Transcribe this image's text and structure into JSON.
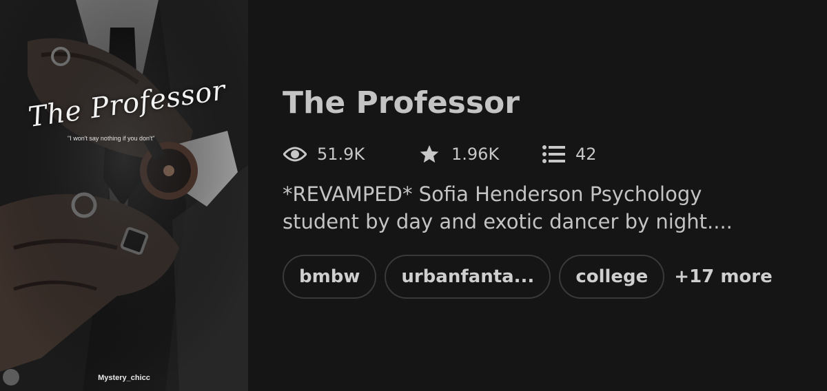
{
  "cover": {
    "title": "The Professor",
    "tagline": "\"I won't say nothing if you don't\"",
    "author": "Mystery_chicc"
  },
  "story": {
    "title": "The Professor",
    "stats": {
      "views": "51.9K",
      "votes": "1.96K",
      "parts": "42"
    },
    "description_lines": [
      "*REVAMPED* Sofia Henderson Psychology",
      "student by day and exotic dancer by night...."
    ],
    "tags": [
      "bmbw",
      "urbanfanta...",
      "college"
    ],
    "more_tags": "+17 more"
  },
  "icons": {
    "views": "eye-icon",
    "votes": "star-icon",
    "parts": "list-icon"
  },
  "colors": {
    "background": "#151515",
    "text": "#c4c4c4",
    "tag_border": "#3a3a3a"
  }
}
